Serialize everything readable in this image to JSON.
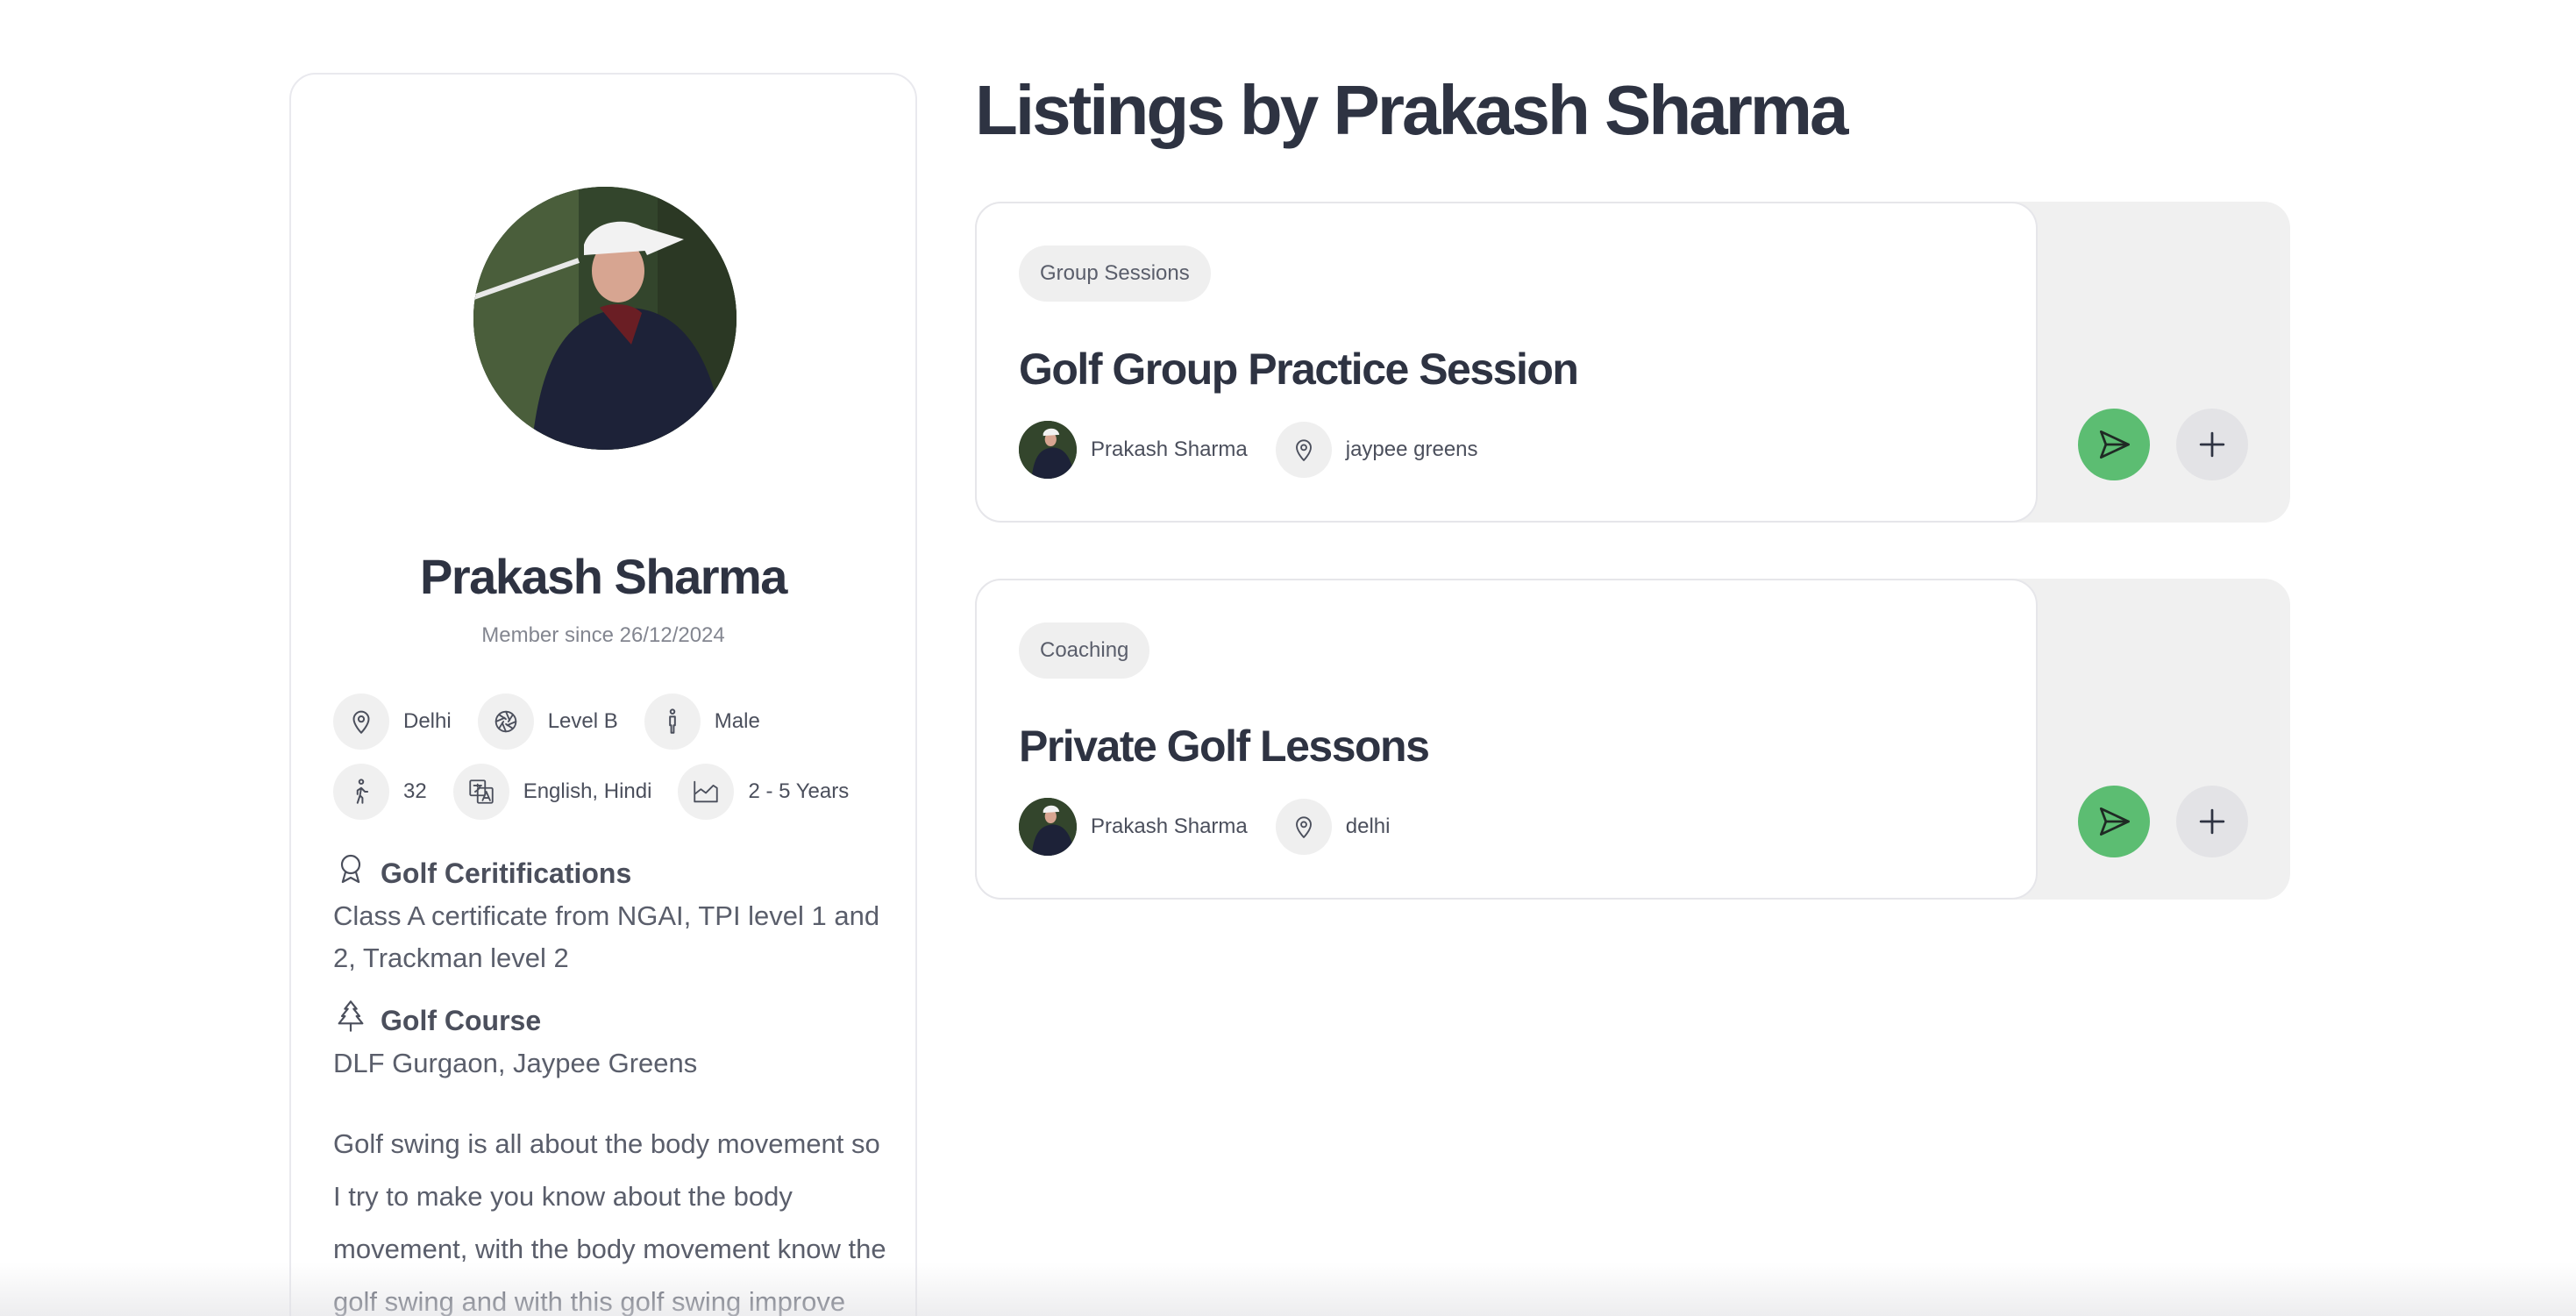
{
  "profile": {
    "name": "Prakash Sharma",
    "member_since": "Member since 26/12/2024",
    "avatar_icon": "golfer-photo",
    "details": [
      {
        "icon": "map-pin-icon",
        "label": "Delhi"
      },
      {
        "icon": "aperture-icon",
        "label": "Level B"
      },
      {
        "icon": "person-standing-icon",
        "label": "Male"
      },
      {
        "icon": "person-walking-icon",
        "label": "32"
      },
      {
        "icon": "language-icon",
        "label": "English, Hindi"
      },
      {
        "icon": "chart-area-icon",
        "label": "2 - 5 Years"
      }
    ],
    "certifications": {
      "icon": "award-icon",
      "title": "Golf Ceritifications",
      "body": "Class A certificate from NGAI, TPI level 1 and 2, Trackman level 2"
    },
    "course": {
      "icon": "tree-icon",
      "title": "Golf Course",
      "body": "DLF Gurgaon, Jaypee Greens"
    },
    "bio": "Golf swing is all about the body movement so I try to make you know about the body movement, with the body movement know the golf swing and with this golf swing improve your golf game. This is the all"
  },
  "listings": {
    "heading": "Listings by Prakash Sharma",
    "items": [
      {
        "category": "Group Sessions",
        "title": "Golf Group Practice Session",
        "host": "Prakash Sharma",
        "location": "jaypee greens"
      },
      {
        "category": "Coaching",
        "title": "Private Golf Lessons",
        "host": "Prakash Sharma",
        "location": "delhi"
      }
    ]
  },
  "colors": {
    "accent_green": "#5cbd72",
    "text_dark": "#2e3342",
    "chip_bg": "#f0f0f0"
  }
}
